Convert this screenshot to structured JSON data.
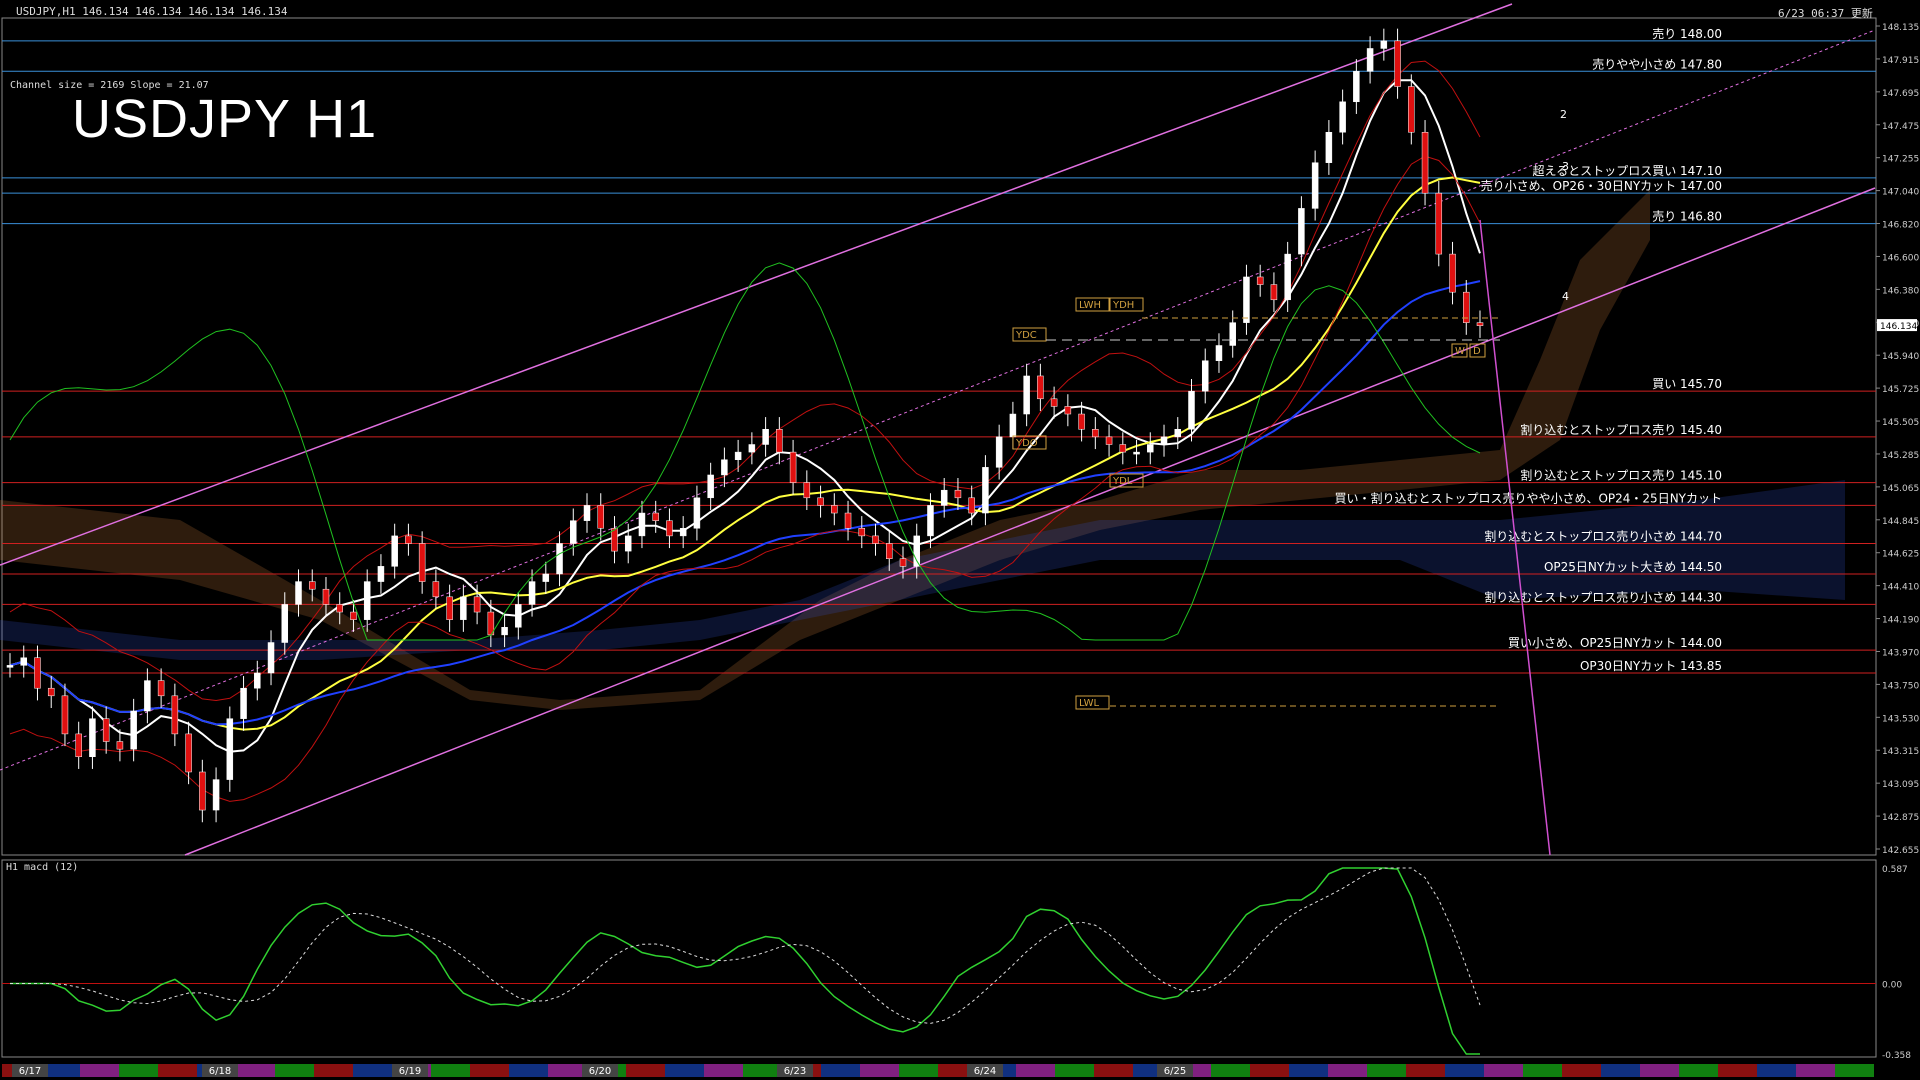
{
  "header": {
    "symbol_info": "USDJPY,H1  146.134 146.134 146.134 146.134",
    "timestamp": "6/23 06:37 更新",
    "channel_info": "Channel size = 2169 Slope = 21.07",
    "big_title": "USDJPY H1",
    "macd_label": "H1  macd (12)"
  },
  "chart_data": {
    "type": "line",
    "instrument": "USDJPY",
    "timeframe": "H1",
    "ylim": [
      142.655,
      148.15
    ],
    "y_ticks": [
      "148.135",
      "147.915",
      "147.695",
      "147.475",
      "147.255",
      "147.040",
      "146.820",
      "146.600",
      "146.380",
      "146.160",
      "145.940",
      "145.725",
      "145.505",
      "145.285",
      "145.065",
      "144.845",
      "144.625",
      "144.410",
      "144.190",
      "143.970",
      "143.750",
      "143.530",
      "143.315",
      "143.095",
      "142.875",
      "142.655"
    ],
    "current_price": "146.134",
    "x_labels": [
      "6/17",
      "6/18",
      "6/19",
      "6/20",
      "6/23",
      "6/24",
      "6/25"
    ],
    "levels": [
      {
        "price": 148.0,
        "label": "売り 148.00",
        "color": "#3a8fd9"
      },
      {
        "price": 147.8,
        "label": "売りやや小さめ 147.80",
        "color": "#3a8fd9"
      },
      {
        "price": 147.1,
        "label": "超えるとストップロス買い 147.10",
        "color": "#3a8fd9"
      },
      {
        "price": 147.0,
        "label": "売り小さめ、OP26・30日NYカット 147.00",
        "color": "#3a8fd9"
      },
      {
        "price": 146.8,
        "label": "売り 146.80",
        "color": "#3a8fd9"
      },
      {
        "price": 145.7,
        "label": "買い 145.70",
        "color": "#d02020"
      },
      {
        "price": 145.4,
        "label": "割り込むとストップロス売り 145.40",
        "color": "#d02020"
      },
      {
        "price": 145.1,
        "label": "割り込むとストップロス売り 145.10",
        "color": "#d02020"
      },
      {
        "price": 144.95,
        "label": "買い・割り込むとストップロス売りやや小さめ、OP24・25日NYカット",
        "color": "#d02020"
      },
      {
        "price": 144.7,
        "label": "割り込むとストップロス売り小さめ 144.70",
        "color": "#d02020"
      },
      {
        "price": 144.5,
        "label": "OP25日NYカット大きめ 144.50",
        "color": "#d02020"
      },
      {
        "price": 144.3,
        "label": "割り込むとストップロス売り小さめ 144.30",
        "color": "#d02020"
      },
      {
        "price": 144.0,
        "label": "買い小さめ、OP25日NYカット 144.00",
        "color": "#d02020"
      },
      {
        "price": 143.85,
        "label": "OP30日NYカット 143.85",
        "color": "#d02020"
      }
    ],
    "tags": [
      "LWH",
      "YDH",
      "YDC",
      "YDO",
      "YDL",
      "LWL",
      "W",
      "D"
    ],
    "wave_labels": [
      "2",
      "3",
      "4"
    ],
    "close_series": [
      143.9,
      143.95,
      143.75,
      143.7,
      143.45,
      143.3,
      143.55,
      143.4,
      143.35,
      143.6,
      143.8,
      143.7,
      143.45,
      143.2,
      142.95,
      143.15,
      143.55,
      143.75,
      143.85,
      144.05,
      144.3,
      144.45,
      144.4,
      144.3,
      144.25,
      144.2,
      144.45,
      144.55,
      144.75,
      144.7,
      144.45,
      144.35,
      144.2,
      144.35,
      144.25,
      144.1,
      144.15,
      144.3,
      144.45,
      144.5,
      144.7,
      144.85,
      144.95,
      144.8,
      144.65,
      144.75,
      144.9,
      144.85,
      144.75,
      144.8,
      145.0,
      145.15,
      145.25,
      145.3,
      145.35,
      145.45,
      145.3,
      145.1,
      145.0,
      144.95,
      144.9,
      144.8,
      144.75,
      144.7,
      144.6,
      144.55,
      144.75,
      144.95,
      145.05,
      145.0,
      144.9,
      145.2,
      145.4,
      145.55,
      145.8,
      145.65,
      145.6,
      145.55,
      145.45,
      145.4,
      145.35,
      145.3,
      145.3,
      145.35,
      145.4,
      145.45,
      145.7,
      145.9,
      146.0,
      146.15,
      146.45,
      146.4,
      146.3,
      146.6,
      146.9,
      147.2,
      147.4,
      147.6,
      147.8,
      147.95,
      148.0,
      147.7,
      147.4,
      147.0,
      146.6,
      146.35,
      146.15,
      146.13
    ],
    "macd": {
      "ylim": [
        -0.358,
        0.587
      ],
      "y_ticks": [
        "0.587",
        "0.00",
        "-0.358"
      ]
    }
  }
}
